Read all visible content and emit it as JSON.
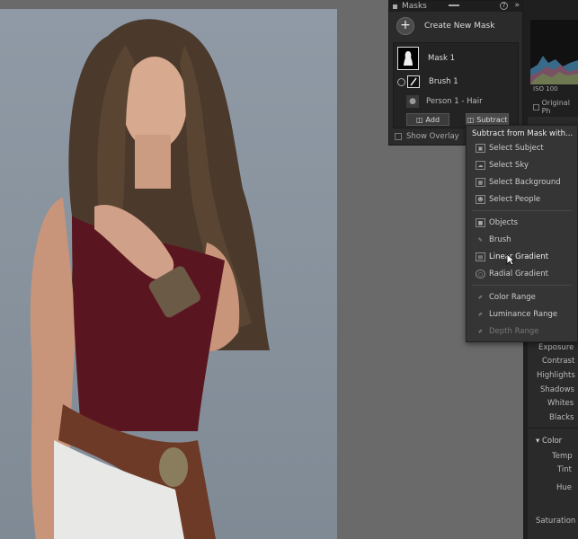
{
  "masks_panel": {
    "title": "Masks",
    "help": "?",
    "collapse": "»",
    "create_new_mask": "Create New Mask",
    "mask_name": "Mask 1",
    "component_brush": "Brush 1",
    "component_person": "Person 1 - Hair",
    "add_label": "Add",
    "subtract_label": "Subtract",
    "show_overlay": "Show Overlay"
  },
  "histogram": {
    "iso": "ISO 100",
    "original_photo": "Original Ph"
  },
  "subtract_menu": {
    "title": "Subtract from Mask with...",
    "items": [
      {
        "label": "Select Subject",
        "icon": "select-subject-icon",
        "disabled": false
      },
      {
        "label": "Select Sky",
        "icon": "select-sky-icon",
        "disabled": false
      },
      {
        "label": "Select Background",
        "icon": "select-background-icon",
        "disabled": false
      },
      {
        "label": "Select People",
        "icon": "select-people-icon",
        "disabled": false
      },
      {
        "label": "Objects",
        "icon": "objects-icon",
        "disabled": false
      },
      {
        "label": "Brush",
        "icon": "brush-icon",
        "disabled": false
      },
      {
        "label": "Linear Gradient",
        "icon": "linear-gradient-icon",
        "disabled": false
      },
      {
        "label": "Radial Gradient",
        "icon": "radial-gradient-icon",
        "disabled": false
      },
      {
        "label": "Color Range",
        "icon": "color-range-icon",
        "disabled": false
      },
      {
        "label": "Luminance Range",
        "icon": "luminance-range-icon",
        "disabled": false
      },
      {
        "label": "Depth Range",
        "icon": "depth-range-icon",
        "disabled": true
      }
    ]
  },
  "adjustments": {
    "exposure": "Exposure",
    "contrast": "Contrast",
    "highlights": "Highlights",
    "shadows": "Shadows",
    "whites": "Whites",
    "blacks": "Blacks",
    "color_section": "Color",
    "temp": "Temp",
    "tint": "Tint",
    "hue": "Hue",
    "saturation": "Saturation"
  },
  "colors": {
    "panel_bg": "#2b2b2b",
    "menu_bg": "#353535",
    "canvas_bg": "#6a6a6a",
    "top_garment": "#5a1620"
  }
}
